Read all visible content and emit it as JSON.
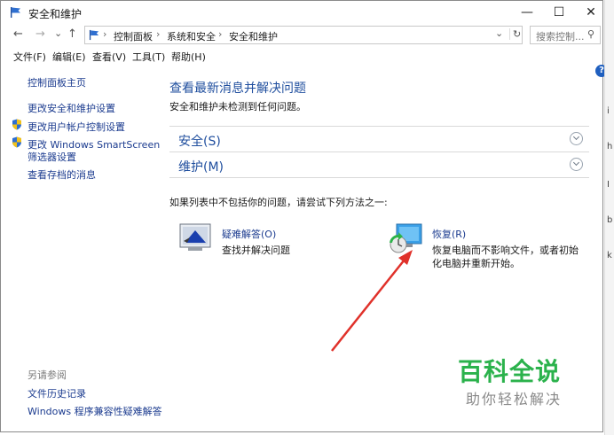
{
  "window": {
    "title": "安全和维护",
    "controls": {
      "minimize": "—",
      "maximize": "☐",
      "close": "✕"
    }
  },
  "nav": {
    "back": "←",
    "forward": "→",
    "recent": "⌄",
    "up": "↑",
    "breadcrumbs": [
      "控制面板",
      "系统和安全",
      "安全和维护"
    ],
    "separator": "›",
    "dropdown": "⌄",
    "refresh": "↻",
    "search_placeholder": "搜索控制...",
    "search_icon": "⚲"
  },
  "menu": [
    "文件(F)",
    "编辑(E)",
    "查看(V)",
    "工具(T)",
    "帮助(H)"
  ],
  "sidebar": {
    "home": "控制面板主页",
    "links": [
      "更改安全和维护设置",
      "更改用户帐户控制设置",
      "更改 Windows SmartScreen",
      "筛选器设置",
      "查看存档的消息"
    ],
    "see_also_title": "另请参阅",
    "see_also": [
      "文件历史记录",
      "Windows 程序兼容性疑难解答"
    ]
  },
  "main": {
    "title": "查看最新消息并解决问题",
    "subtitle": "安全和维护未检测到任何问题。",
    "sections": [
      "安全(S)",
      "维护(M)"
    ],
    "hint": "如果列表中不包括你的问题，请尝试下列方法之一:",
    "troubleshoot": {
      "link": "疑难解答(O)",
      "desc": "查找并解决问题"
    },
    "recovery": {
      "link": "恢复(R)",
      "desc_line1": "恢复电脑而不影响文件，或者初始",
      "desc_line2": "化电脑并重新开始。"
    },
    "help_icon": "?"
  },
  "watermark": {
    "title": "百科全说",
    "subtitle": "助你轻松解决"
  },
  "right_strip_glyphs": [
    "i",
    "h",
    "I",
    "b",
    "k"
  ],
  "colors": {
    "link": "#1b3b8f",
    "heading": "#1f4e9e",
    "arrow": "#e0312a",
    "watermark_green": "#2bb24c",
    "shield_blue": "#2f6fd0",
    "shield_yellow": "#f2c21a"
  }
}
